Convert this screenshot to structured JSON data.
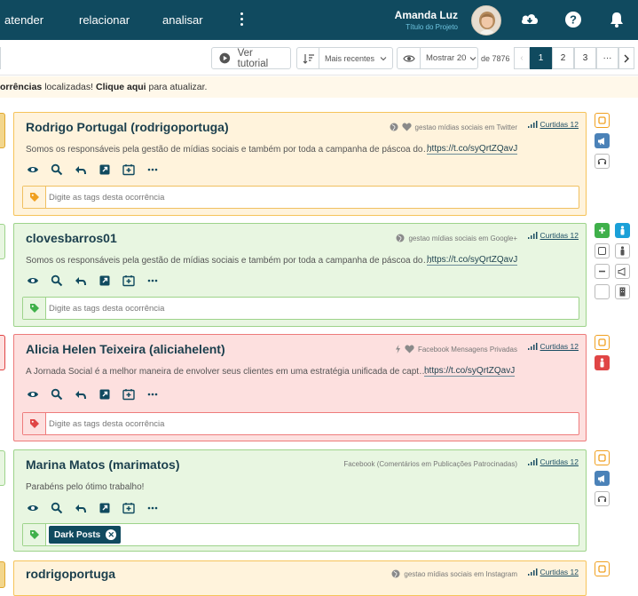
{
  "nav": {
    "items": [
      "atender",
      "relacionar",
      "analisar"
    ],
    "user_name": "Amanda Luz",
    "project": "Título do Projeto"
  },
  "toolbar": {
    "tutorial": "Ver tutorial",
    "sort": "Mais recentes",
    "show": "Mostrar 20",
    "total": "de 7876",
    "pages": [
      "1",
      "2",
      "3",
      "···"
    ],
    "current_page": "1"
  },
  "notice": {
    "part1": "orrências",
    "part2": " localizadas! ",
    "part3": "Clique aqui",
    "part4": " para atualizar."
  },
  "cards": [
    {
      "title": "Rodrigo Portugal (rodrigoportuga)",
      "source": "gestao mídias sociais em Twitter",
      "curtidas": "Curtidas 12",
      "text": "Somos os responsáveis pela gestão de mídias sociais e também por toda a campanha de páscoa do…",
      "link": "https://t.co/syQrtZQavJ",
      "tag_placeholder": "Digite as tags desta ocorrência"
    },
    {
      "title": "clovesbarros01",
      "source": "gestao mídias sociais em Google+",
      "curtidas": "Curtidas 12",
      "text": "Somos os responsáveis pela gestão de mídias sociais e também por toda a campanha de páscoa do…",
      "link": "https://t.co/syQrtZQavJ",
      "tag_placeholder": "Digite as tags desta ocorrência"
    },
    {
      "title": "Alicia Helen Teixeira (aliciahelent)",
      "source": "Facebook Mensagens Privadas",
      "curtidas": "Curtidas 12",
      "text": "A Jornada Social é a melhor maneira de envolver seus clientes em uma estratégia unificada de capt…",
      "link": "https://t.co/syQrtZQavJ",
      "tag_placeholder": "Digite as tags desta ocorrência"
    },
    {
      "title": "Marina Matos (marimatos)",
      "source": "Facebook (Comentários em Publicações Patrocinadas)",
      "curtidas": "Curtidas 12",
      "text": "Parabéns pelo ótimo trabalho!",
      "tag_chip": "Dark Posts"
    },
    {
      "title": "rodrigoportuga",
      "source": "gestao mídias sociais em Instagram",
      "curtidas": "Curtidas 12"
    }
  ],
  "colors": {
    "navbar": "#104a5f",
    "orange_card": "#fff3dc",
    "green_card": "#e8f6e1",
    "red_card": "#fde0df"
  }
}
